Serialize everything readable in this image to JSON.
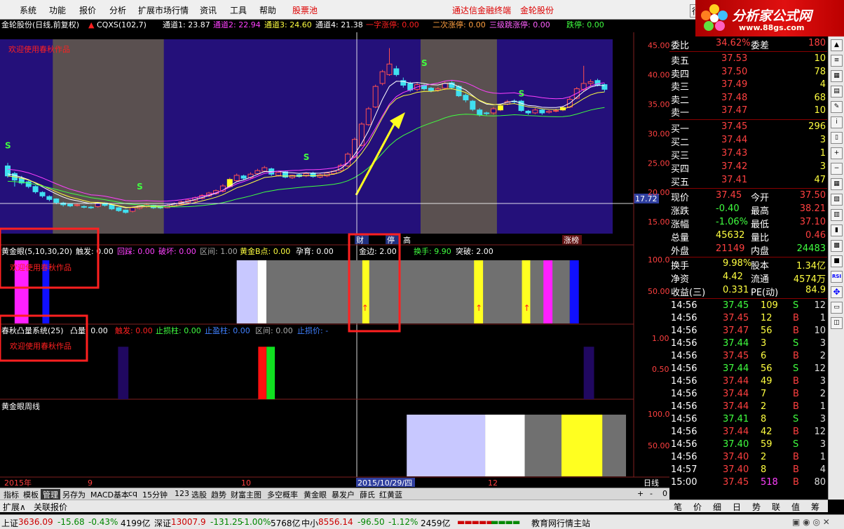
{
  "menu": {
    "items": [
      "系统",
      "功能",
      "报价",
      "分析",
      "扩展市场行情",
      "资讯",
      "工具",
      "帮助"
    ],
    "highlight": "股票池",
    "right_items": [
      "通达信金融终端",
      "金轮股份"
    ],
    "trade_btn": "行"
  },
  "logo": {
    "title": "分析家公式网",
    "url": "www.88gs.com"
  },
  "main_header": {
    "stock": "金轮股份(日线,前复权)",
    "indicator": "CQXS(102,7)",
    "items": [
      {
        "label": "通道1: 23.87",
        "color": "#ffffff"
      },
      {
        "label": "通道2: 22.94",
        "color": "#ff40ff"
      },
      {
        "label": "通道3: 24.60",
        "color": "#ffff40"
      },
      {
        "label": "通道4: 21.38",
        "color": "#ffffff"
      },
      {
        "label": "一字涨停: 0.00",
        "color": "#ff2020"
      },
      {
        "label": "二次涨停: 0.00",
        "color": "#ffa040"
      },
      {
        "label": "三级跳涨停: 0.00",
        "color": "#ff60ff"
      },
      {
        "label": "跌停: 0.00",
        "color": "#40ff40"
      }
    ],
    "welcome": "欢迎使用春秋作品"
  },
  "panel2": {
    "name": "黄金眼(5,10,30,20)",
    "items": [
      {
        "label": "触发: 0.00",
        "color": "#ffffff"
      },
      {
        "label": "回踩: 0.00",
        "color": "#ff40ff"
      },
      {
        "label": "破坏: 0.00",
        "color": "#ff40ff"
      },
      {
        "label": "区间: 1.00",
        "color": "#aaaaaa"
      },
      {
        "label": "黄金B点: 0.00",
        "color": "#ffff40"
      },
      {
        "label": "孕育: 0.00",
        "color": "#ffffff"
      },
      {
        "label": "金边: 2.00",
        "color": "#ffffff"
      },
      {
        "label": "换手: 9.90",
        "color": "#40ff40"
      },
      {
        "label": "突破: 2.00",
        "color": "#ffffff"
      }
    ],
    "welcome": "欢迎使用春秋作品",
    "yaxis": [
      "100.0",
      "50.00"
    ]
  },
  "panel3": {
    "name": "春秋凸量系统(25)",
    "items": [
      {
        "label": "凸量: 0.00",
        "color": "#ffffff"
      },
      {
        "label": "触发: 0.00",
        "color": "#ff2020"
      },
      {
        "label": "止损柱: 0.00",
        "color": "#40ff40"
      },
      {
        "label": "止盈柱: 0.00",
        "color": "#4080ff"
      },
      {
        "label": "区间: 0.00",
        "color": "#aaaaaa"
      },
      {
        "label": "止损价: -",
        "color": "#4080ff"
      }
    ],
    "welcome": "欢迎使用春秋作品",
    "yaxis": [
      "1.00",
      "0.50"
    ]
  },
  "panel4": {
    "name": "黄金眼周线",
    "yaxis": [
      "100.0",
      "50.00"
    ]
  },
  "main_axis": {
    "ticks": [
      "45.00",
      "40.00",
      "35.00",
      "30.00",
      "25.00",
      "20.00",
      "15.00"
    ],
    "cursor_price": "17.72"
  },
  "xaxis": {
    "labels": [
      "2015年",
      "9",
      "10",
      "2015/10/29/四",
      "12"
    ],
    "period": "日线"
  },
  "markers": {
    "cai": "财",
    "ting": "停",
    "gao": "高",
    "zhangbang": "涨榜"
  },
  "bottom_tabs": [
    "指标",
    "模板",
    "管理",
    "另存为",
    "MACD基本",
    "cq",
    "15分钟",
    "123",
    "选股",
    "趋势",
    "财富主图",
    "多空概率",
    "黄金眼",
    "暴发户",
    "薛氏",
    "红黄蓝"
  ],
  "bottom_tab_selected": "管理",
  "scroll_btns": [
    "+",
    "-",
    "0"
  ],
  "tabs2": [
    "扩展∧",
    "关联报价"
  ],
  "side_tabs": [
    "笔",
    "价",
    "细",
    "日",
    "势",
    "联",
    "值",
    "筹"
  ],
  "quote": {
    "weibi": {
      "label": "委比",
      "value": "34.62%",
      "label2": "委差",
      "value2": "180"
    },
    "sell": [
      {
        "label": "卖五",
        "price": "37.53",
        "vol": "10"
      },
      {
        "label": "卖四",
        "price": "37.50",
        "vol": "78"
      },
      {
        "label": "卖三",
        "price": "37.49",
        "vol": "4"
      },
      {
        "label": "卖二",
        "price": "37.48",
        "vol": "68"
      },
      {
        "label": "卖一",
        "price": "37.47",
        "vol": "10"
      }
    ],
    "buy": [
      {
        "label": "买一",
        "price": "37.45",
        "vol": "296"
      },
      {
        "label": "买二",
        "price": "37.44",
        "vol": "3"
      },
      {
        "label": "买三",
        "price": "37.43",
        "vol": "1"
      },
      {
        "label": "买四",
        "price": "37.42",
        "vol": "3"
      },
      {
        "label": "买五",
        "price": "37.41",
        "vol": "47"
      }
    ],
    "stats": [
      {
        "l1": "现价",
        "v1": "37.45",
        "c1": "#ff4040",
        "l2": "今开",
        "v2": "37.50",
        "c2": "#ff4040"
      },
      {
        "l1": "涨跌",
        "v1": "-0.40",
        "c1": "#40ff40",
        "l2": "最高",
        "v2": "38.21",
        "c2": "#ff4040"
      },
      {
        "l1": "涨幅",
        "v1": "-1.06%",
        "c1": "#40ff40",
        "l2": "最低",
        "v2": "37.10",
        "c2": "#ff4040"
      },
      {
        "l1": "总量",
        "v1": "45632",
        "c1": "#ffff40",
        "l2": "量比",
        "v2": "0.46",
        "c2": "#ff4040"
      },
      {
        "l1": "外盘",
        "v1": "21149",
        "c1": "#ff4040",
        "l2": "内盘",
        "v2": "24483",
        "c2": "#40ff40"
      }
    ],
    "stats2": [
      {
        "l1": "换手",
        "v1": "9.98%",
        "l2": "股本",
        "v2": "1.34亿"
      },
      {
        "l1": "净资",
        "v1": "4.42",
        "l2": "流通",
        "v2": "4574万"
      },
      {
        "l1": "收益(三)",
        "v1": "0.331",
        "l2": "PE(动)",
        "v2": "84.9"
      }
    ],
    "ticks": [
      {
        "t": "14:56",
        "p": "37.45",
        "v": "109",
        "d": "S",
        "n": "12"
      },
      {
        "t": "14:56",
        "p": "37.45",
        "v": "12",
        "d": "B",
        "n": "1"
      },
      {
        "t": "14:56",
        "p": "37.47",
        "v": "56",
        "d": "B",
        "n": "10"
      },
      {
        "t": "14:56",
        "p": "37.44",
        "v": "3",
        "d": "S",
        "n": "3"
      },
      {
        "t": "14:56",
        "p": "37.45",
        "v": "6",
        "d": "B",
        "n": "2"
      },
      {
        "t": "14:56",
        "p": "37.44",
        "v": "56",
        "d": "S",
        "n": "12"
      },
      {
        "t": "14:56",
        "p": "37.44",
        "v": "49",
        "d": "B",
        "n": "3"
      },
      {
        "t": "14:56",
        "p": "37.44",
        "v": "7",
        "d": "B",
        "n": "2"
      },
      {
        "t": "14:56",
        "p": "37.44",
        "v": "2",
        "d": "B",
        "n": "1"
      },
      {
        "t": "14:56",
        "p": "37.41",
        "v": "8",
        "d": "S",
        "n": "3"
      },
      {
        "t": "14:56",
        "p": "37.44",
        "v": "42",
        "d": "B",
        "n": "12"
      },
      {
        "t": "14:56",
        "p": "37.40",
        "v": "59",
        "d": "S",
        "n": "3"
      },
      {
        "t": "14:56",
        "p": "37.40",
        "v": "2",
        "d": "B",
        "n": "1"
      },
      {
        "t": "14:57",
        "p": "37.40",
        "v": "8",
        "d": "B",
        "n": "4"
      },
      {
        "t": "15:00",
        "p": "37.45",
        "v": "518",
        "d": "B",
        "n": "80"
      }
    ]
  },
  "status": {
    "sh": {
      "name": "上证",
      "idx": "3636.09",
      "chg": "-15.68",
      "pct": "-0.43%",
      "amt": "4199亿"
    },
    "sz": {
      "name": "深证",
      "idx": "13007.9",
      "chg": "-131.25",
      "pct": "-1.00%",
      "amt": "5768亿"
    },
    "zx": {
      "name": "中小",
      "idx": "8556.14",
      "chg": "-96.50",
      "pct": "-1.12%",
      "amt": "2459亿"
    },
    "site": "教育网行情主站"
  },
  "chart_data": [
    {
      "type": "candlestick",
      "title": "金轮股份(日线,前复权)",
      "ylim": [
        13,
        46
      ],
      "yticks": [
        45,
        40,
        35,
        30,
        25,
        20,
        15
      ],
      "shaded_ranges": [
        [
          7,
          22
        ],
        [
          60,
          70
        ]
      ],
      "open": [
        24.5,
        23.2,
        22.4,
        21.8,
        21.0,
        20.0,
        19.3,
        18.9,
        18.2,
        18.0,
        17.8,
        17.6,
        17.5,
        17.6,
        18.2,
        17.9,
        17.4,
        17.0,
        16.8,
        17.3,
        17.6,
        17.8,
        17.5,
        17.4,
        17.7,
        18.0,
        18.3,
        18.6,
        19.0,
        19.4,
        19.8,
        20.2,
        21.0,
        22.0,
        22.8,
        22.5,
        23.2,
        23.6,
        24.0,
        22.9,
        23.5,
        22.5,
        23.0,
        22.8,
        23.3,
        22.6,
        22.8,
        23.2,
        23.7,
        24.5,
        26.0,
        28.0,
        31.5,
        34.5,
        38.5,
        40.0,
        41.0,
        39.0,
        38.5,
        37.5,
        38.2,
        37.7,
        37.4,
        37.7,
        38.6,
        38.0,
        36.5,
        35.5,
        34.0,
        33.5,
        33.5,
        34.0,
        35.0,
        35.5,
        35.5,
        33.8,
        33.5,
        34.0,
        33.6,
        33.8,
        34.0,
        34.5,
        36.0,
        37.5,
        38.5,
        39.0,
        38.3
      ],
      "close": [
        22.8,
        22.1,
        21.6,
        21.0,
        20.1,
        19.4,
        18.8,
        18.3,
        17.9,
        17.7,
        17.9,
        17.5,
        17.4,
        18.2,
        17.8,
        17.2,
        16.9,
        16.6,
        17.4,
        17.7,
        17.9,
        17.4,
        17.4,
        17.8,
        18.1,
        18.4,
        18.7,
        19.1,
        19.5,
        19.9,
        20.3,
        21.1,
        22.2,
        22.9,
        22.4,
        23.1,
        23.7,
        24.2,
        23.1,
        23.4,
        22.6,
        22.9,
        22.7,
        23.2,
        22.7,
        23.0,
        23.3,
        23.6,
        24.6,
        26.5,
        29.0,
        31.6,
        34.2,
        38.0,
        40.5,
        41.8,
        40.0,
        38.2,
        37.4,
        38.3,
        37.6,
        37.3,
        37.6,
        38.5,
        37.8,
        36.4,
        35.7,
        34.1,
        33.2,
        33.4,
        34.2,
        34.7,
        35.4,
        35.4,
        33.9,
        33.5,
        34.0,
        33.5,
        33.8,
        33.9,
        34.4,
        35.8,
        37.6,
        38.5,
        38.8,
        38.2,
        37.5
      ],
      "high": [
        25.0,
        23.5,
        22.8,
        22.0,
        21.2,
        20.2,
        19.5,
        19.0,
        18.4,
        18.1,
        18.1,
        17.8,
        17.7,
        18.4,
        18.3,
        18.0,
        17.5,
        17.1,
        17.6,
        17.9,
        18.1,
        17.9,
        17.6,
        18.0,
        18.3,
        18.6,
        18.9,
        19.3,
        19.7,
        20.1,
        20.5,
        21.4,
        22.5,
        23.2,
        23.0,
        23.4,
        24.0,
        24.5,
        24.2,
        23.6,
        23.7,
        23.0,
        23.2,
        23.4,
        23.5,
        23.2,
        23.5,
        23.8,
        24.9,
        26.8,
        29.3,
        31.9,
        34.5,
        38.3,
        40.8,
        44.5,
        41.5,
        39.5,
        38.8,
        38.6,
        38.4,
        37.9,
        37.9,
        38.8,
        38.9,
        38.2,
        36.8,
        35.7,
        34.3,
        33.7,
        34.5,
        35.0,
        35.7,
        35.8,
        35.7,
        34.0,
        34.3,
        34.2,
        34.0,
        34.2,
        34.7,
        36.2,
        37.9,
        41.5,
        39.2,
        39.3,
        38.5
      ],
      "low": [
        22.5,
        21.0,
        21.3,
        20.7,
        19.8,
        19.1,
        18.5,
        18.0,
        17.6,
        17.5,
        17.6,
        17.3,
        17.2,
        17.4,
        17.6,
        17.0,
        16.7,
        16.4,
        16.6,
        17.1,
        17.4,
        17.2,
        17.2,
        17.3,
        17.5,
        17.8,
        18.1,
        18.4,
        18.8,
        19.2,
        19.6,
        20.0,
        20.8,
        21.8,
        22.1,
        22.3,
        23.0,
        23.4,
        22.8,
        22.7,
        22.4,
        22.3,
        22.5,
        22.6,
        22.5,
        22.4,
        22.6,
        23.0,
        23.5,
        24.3,
        25.8,
        27.8,
        31.3,
        34.3,
        38.2,
        39.8,
        39.7,
        37.8,
        37.1,
        37.2,
        37.3,
        37.0,
        37.1,
        37.4,
        37.5,
        36.2,
        35.3,
        33.8,
        32.9,
        33.1,
        33.2,
        33.8,
        34.8,
        35.1,
        33.7,
        33.2,
        33.3,
        33.2,
        33.4,
        33.6,
        33.8,
        34.3,
        35.8,
        37.2,
        38.1,
        38.0,
        37.1
      ],
      "series": [
        {
          "name": "通道1",
          "color": "#ffffff"
        },
        {
          "name": "通道2",
          "color": "#ff40ff"
        },
        {
          "name": "通道3",
          "color": "#ffff40"
        },
        {
          "name": "通道4",
          "color": "#40ff40"
        }
      ]
    },
    {
      "type": "bar",
      "title": "黄金眼(5,10,30,20)",
      "ylim": [
        0,
        100
      ],
      "bars": [
        {
          "x": [
            1.5,
            3.5
          ],
          "color": "#ff20ff"
        },
        {
          "x": [
            5.5,
            6.5
          ],
          "color": "#1010ff"
        },
        {
          "x": [
            33.5,
            36.5
          ],
          "color": "#c8c8ff"
        },
        {
          "x": [
            36.5,
            37.8
          ],
          "color": "#ffffff"
        },
        {
          "x": [
            37.8,
            81.5
          ],
          "color": "#707070"
        },
        {
          "x": [
            51.6,
            52.6
          ],
          "color": "#ffff20"
        },
        {
          "x": [
            67.7,
            69.0
          ],
          "color": "#ffff20"
        },
        {
          "x": [
            74.6,
            75.8
          ],
          "color": "#ffff20"
        },
        {
          "x": [
            77.7,
            79.0
          ],
          "color": "#ff20ff"
        },
        {
          "x": [
            81.5,
            82.8
          ],
          "color": "#1010ff"
        }
      ],
      "arrows": [
        51.9,
        68.3,
        75.2
      ]
    },
    {
      "type": "bar",
      "title": "春秋凸量系统(25)",
      "ylim": [
        0,
        1.15
      ],
      "bars": [
        {
          "x": [
            16.4,
            17.9
          ],
          "value": 1.0,
          "color": "#200860"
        },
        {
          "x": [
            36.6,
            37.8
          ],
          "value": 1.0,
          "color": "#ff1010"
        },
        {
          "x": [
            37.8,
            39.0
          ],
          "value": 1.0,
          "color": "#10e020"
        },
        {
          "x": [
            83.5,
            85.0
          ],
          "value": 1.0,
          "color": "#200860"
        }
      ]
    },
    {
      "type": "bar",
      "title": "黄金眼周线",
      "ylim": [
        0,
        100
      ],
      "bars": [
        {
          "x": [
            58.0,
            69.3
          ],
          "color": "#c8c8ff"
        },
        {
          "x": [
            69.3,
            75.0
          ],
          "color": "#ffffff"
        },
        {
          "x": [
            75.0,
            80.3
          ],
          "color": "#707070"
        },
        {
          "x": [
            80.3,
            86.2
          ],
          "color": "#ffff20"
        },
        {
          "x": [
            86.2,
            89.6
          ],
          "color": "#707070"
        }
      ]
    }
  ]
}
